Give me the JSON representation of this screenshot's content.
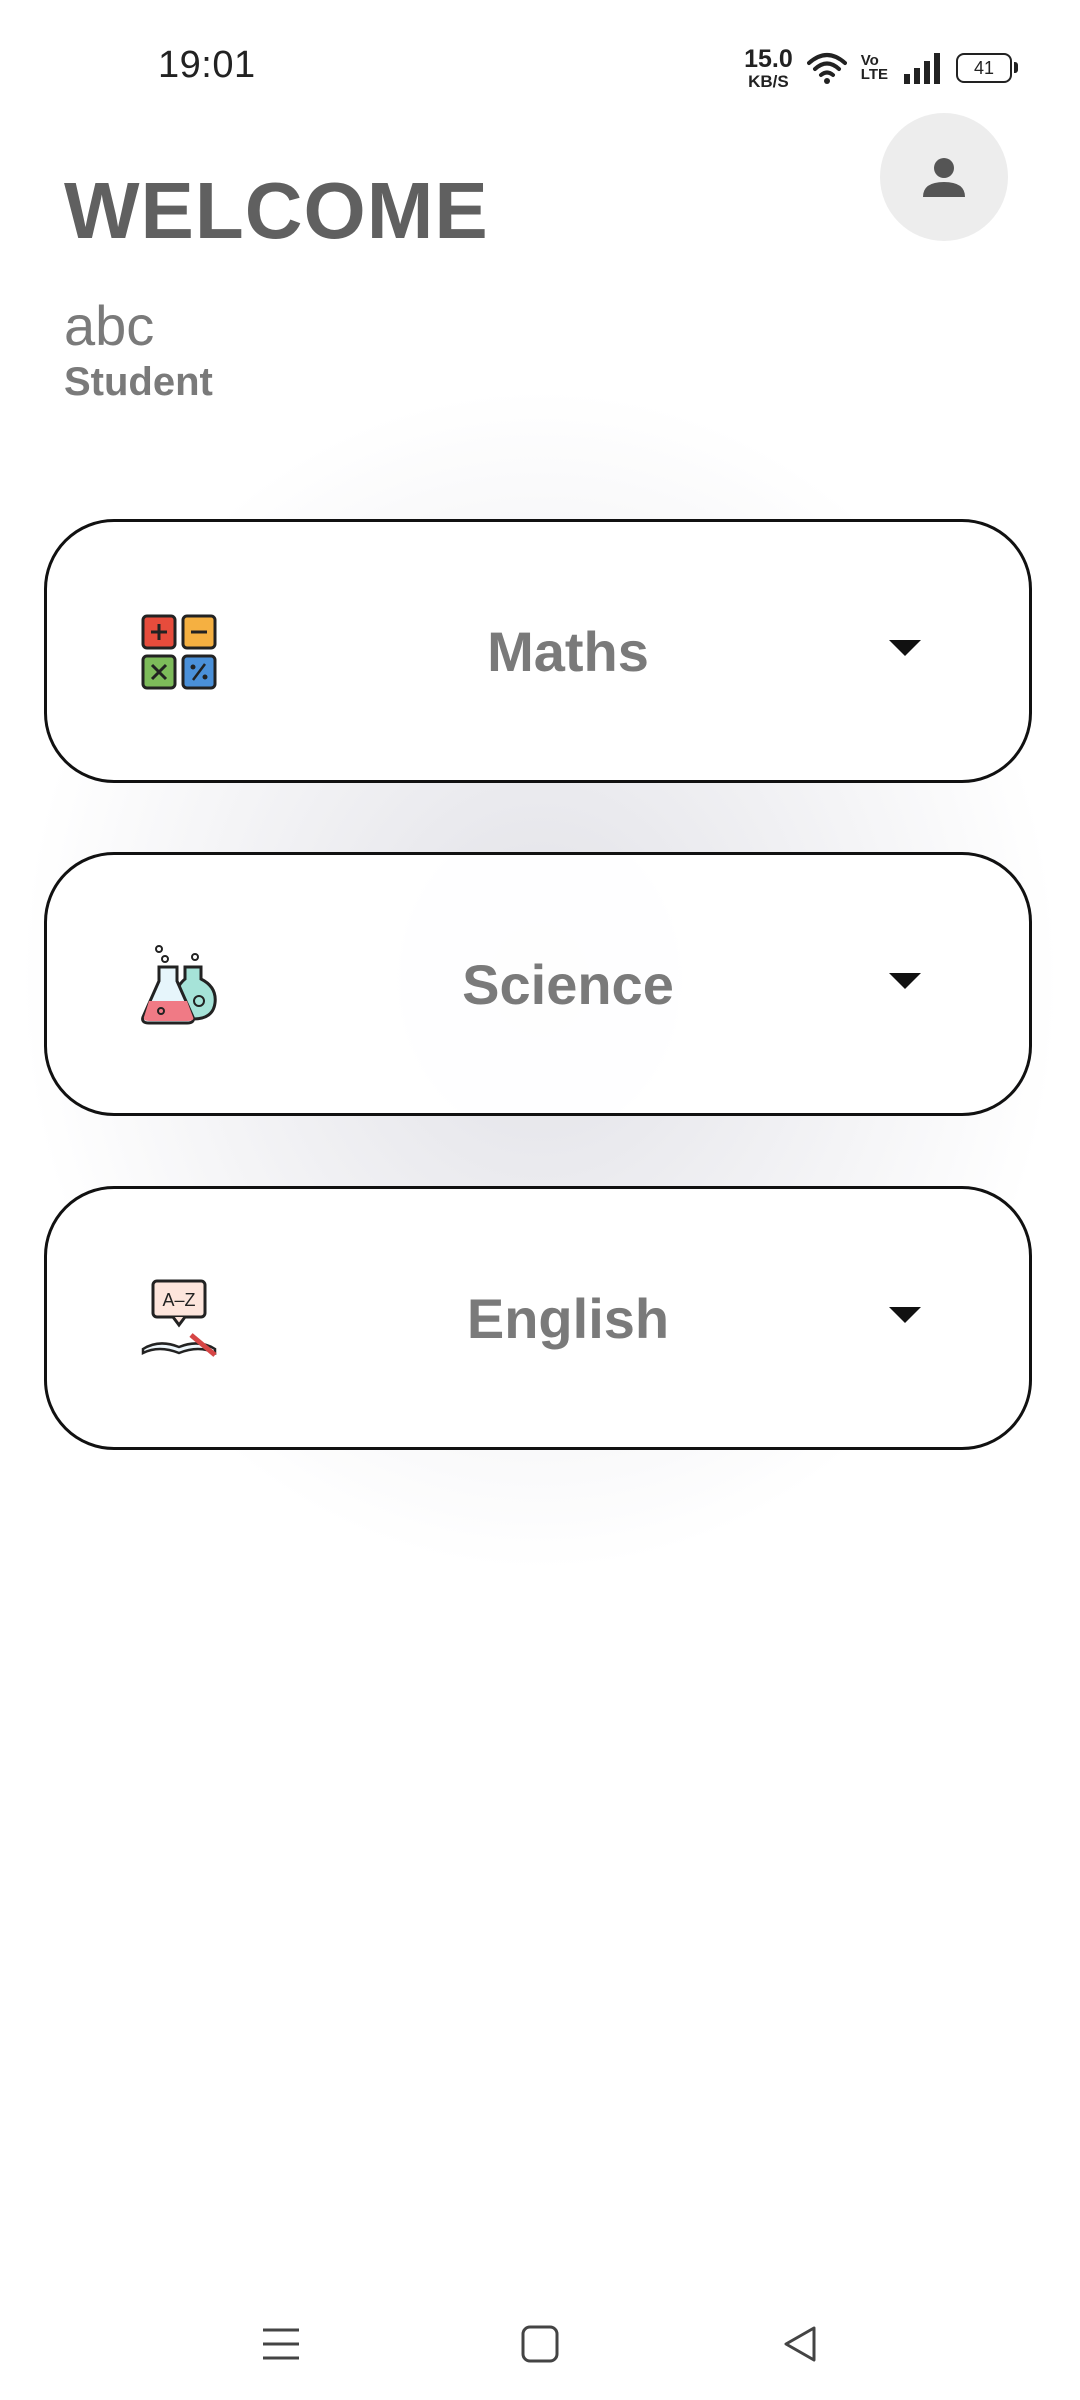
{
  "status_bar": {
    "time": "19:01",
    "net_speed_value": "15.0",
    "net_speed_unit": "KB/S",
    "volte_top": "Vo",
    "volte_bottom": "LTE",
    "battery": "41",
    "icons": [
      "wifi-icon",
      "signal-icon",
      "battery-icon"
    ]
  },
  "header": {
    "title": "WELCOME",
    "user_name": "abc",
    "user_role": "Student",
    "profile_icon": "person-icon"
  },
  "subjects": [
    {
      "label": "Maths",
      "icon": "calculator-icon"
    },
    {
      "label": "Science",
      "icon": "flask-icon"
    },
    {
      "label": "English",
      "icon": "dictionary-icon"
    }
  ],
  "nav_bar": {
    "buttons": [
      "menu-icon",
      "home-square-icon",
      "back-triangle-icon"
    ]
  },
  "colors": {
    "title": "#606060",
    "subtitle": "#7a7a7a",
    "card_border": "#111111",
    "profile_bg": "#ededed"
  }
}
